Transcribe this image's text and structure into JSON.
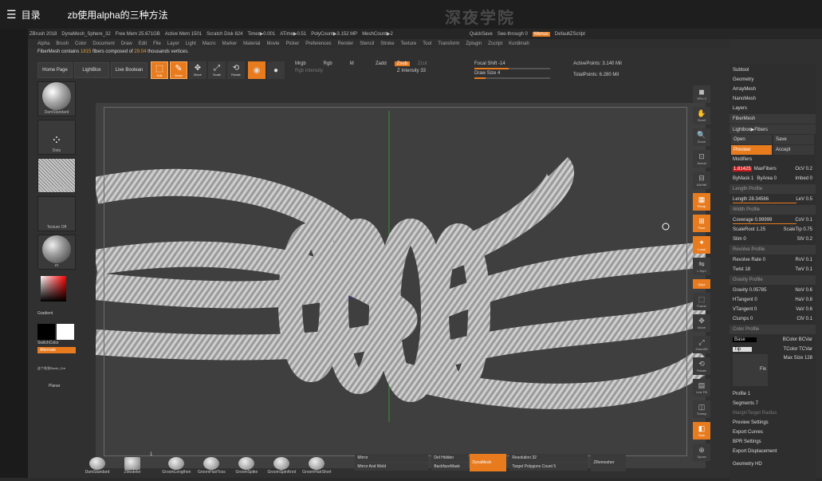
{
  "top": {
    "toc": "目录",
    "video_title": "zb使用alpha的三种方法",
    "watermark": "深夜学院"
  },
  "menubar": {
    "items": [
      "ZBrush 2018",
      "DynaMesh_Sphere_32",
      "Free Mem 25.671GB",
      "Active Mem 1501",
      "Scratch Disk 824",
      "Timer▶0.001",
      "ATime▶0.51",
      "PolyCount▶3.152 MP",
      "MeshCount▶2"
    ],
    "quicksave": "QuickSave",
    "seethrough": "See-through 0",
    "menus": "Menus",
    "script": "DefaultZScript"
  },
  "menu2": [
    "Alpha",
    "Brush",
    "Color",
    "Document",
    "Draw",
    "Edit",
    "File",
    "Layer",
    "Light",
    "Macro",
    "Marker",
    "Material",
    "Movie",
    "Picker",
    "Preferences",
    "Render",
    "Stencil",
    "Stroke",
    "Texture",
    "Tool",
    "Transform",
    "Zplugin",
    "Zscript",
    "Kurdimah"
  ],
  "infoline": {
    "pre": "FiberMesh contains ",
    "fibers": "1815",
    "mid": " fibers composed of ",
    "verts": "29.04",
    "post": " thousands vertices."
  },
  "toolbar": {
    "home": "Home Page",
    "lightbox": "LightBox",
    "liveboolean": "Live Boolean",
    "edit": "Edit",
    "draw": "Draw",
    "move": "Move",
    "scale": "Scale",
    "rotate": "Rotate",
    "mrgb": "Mrgb",
    "rgb": "Rgb",
    "m": "M",
    "rgb_intensity": "Rgb Intensity",
    "zadd": "Zadd",
    "zsub": "Zsub",
    "zcut": "Zcut",
    "z_intensity": "Z Intensity 33",
    "focal": "Focal Shift -14",
    "drawsize": "Draw Size 4",
    "dynamic": "Dynamic",
    "active_points": "ActivePoints: 3.140 Mil",
    "total_points": "TotalPoints: 6.280 Mil"
  },
  "left": {
    "brush": "DamStandard",
    "stroke": "Dots",
    "alpha": "BrushAlpha",
    "texture": "Texture Off",
    "material": "zx",
    "gradient": "Gradient",
    "switchcolor": "SwitchColor",
    "alternate": "Alternate",
    "tool1": "这个毛发Brush_Cre",
    "tool2": "Planar"
  },
  "right": {
    "spix": "SPix 3",
    "scroll": "Scroll",
    "zoom": "Zoom",
    "actual": "Actual",
    "aahalf": "AAHalf",
    "persp": "Persp",
    "floor": "Floor",
    "local": "Local",
    "lsym": "L.Sym",
    "xyz": "Qxyz",
    "frame": "Frame",
    "move": "Move",
    "zoom3d": "Zoom3D",
    "rotate": "Rotate",
    "linefill": "Line Fill",
    "polyf": "PolyF",
    "transp": "Transp",
    "ghost": "Ghost",
    "solo": "Solo",
    "xpose": "Xpose"
  },
  "panel": {
    "subtool": "Subtool",
    "geometry": "Geometry",
    "arraymesh": "ArrayMesh",
    "nanomesh": "NanoMesh",
    "layers": "Layers",
    "fibermesh": "FiberMesh",
    "lightbox_fibers": "Lightbox▶Fibers",
    "open": "Open",
    "save": "Save",
    "preview": "Preview",
    "accept": "Accept",
    "modifiers": "Modifiers",
    "maxfibers": "MaxFibers",
    "maxfibers_val": "1.81425",
    "ocv": "OcV 0.2",
    "bymask": "ByMask 1",
    "byarea": "ByArea 0",
    "imbed": "Imbed 0",
    "length_profile": "Length Profile",
    "length": "Length 28.34566",
    "lev": "LeV 0.5",
    "width_profile": "Width Profile",
    "coverage": "Coverage 0.99999",
    "cov": "CoV 0.1",
    "scaleroot": "ScaleRoot 1.25",
    "scaletip": "ScaleTip 0.75",
    "slim": "Slim 0",
    "slv": "SlV 0.2",
    "revolve_profile": "Revolve Profile",
    "revolve": "Revolve Rate 0",
    "rev": "RvV 0.1",
    "twist": "Twist 18",
    "twv": "TwV 0.1",
    "gravity_profile": "Gravity Profile",
    "gravity": "Gravity 0.05785",
    "nov": "NoV 0.6",
    "htangent": "HTangent 0",
    "hav": "HaV 0.8",
    "vtangent": "VTangent 0",
    "vav": "VaV 0.6",
    "clumps": "Clumps 0",
    "clv": "ClV 0.1",
    "color_profile": "Color Profile",
    "base": "Base",
    "bcolor": "BColor",
    "bcvar": "BCVar",
    "tip": "Tip",
    "tcolor": "TColor",
    "tcvar": "TCVar",
    "max_size": "Max Size 128",
    "fix": "Fix",
    "profile": "Profile 1",
    "segments": "Segments 7",
    "margin_target": "MarginTarget Radius",
    "preview_settings": "Preview Settings",
    "export_curves": "Export Curves",
    "bpr": "BPR Settings",
    "export_displ": "Export Displacement",
    "geometry_hd": "Geometry HD"
  },
  "bottom": {
    "b1": "DamStandard",
    "b2": "ZModeler",
    "b2n": "1",
    "b3": "GroomLengthen",
    "b4": "GroomHairToss",
    "b5": "GroomSpike",
    "b6": "GroomSpinKnot",
    "b7": "GroomHairShort",
    "mirror": "Mirror",
    "mirror_weld": "Mirror And Weld",
    "delhidden": "Del Hidden",
    "backface": "BackfaceMask",
    "dynamesh": "DynaMesh",
    "resolution": "Resolution 32",
    "target_poly": "Target Polygons Count 5",
    "zremesher": "ZRemesher"
  }
}
